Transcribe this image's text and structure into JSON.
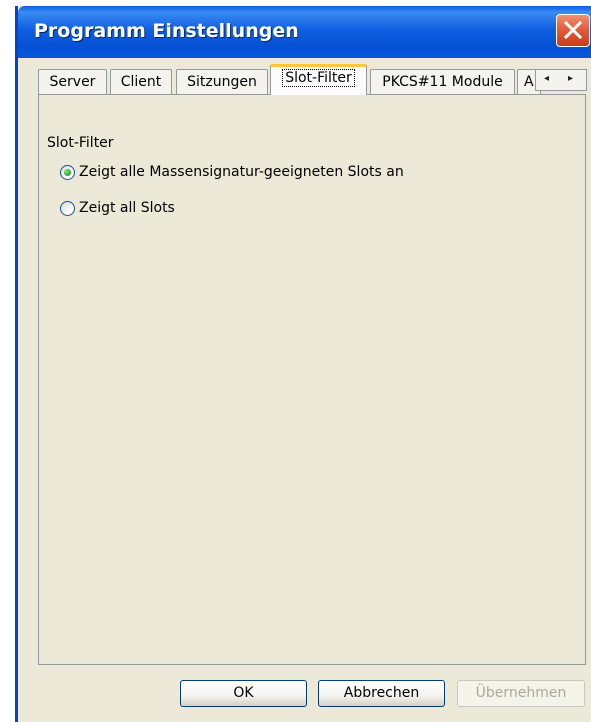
{
  "window": {
    "title": "Programm Einstellungen",
    "close_icon": "close-icon",
    "titlebar_color": "#0a5ee6",
    "close_color": "#e25e3c"
  },
  "tabs": [
    {
      "label": "Server",
      "active": false
    },
    {
      "label": "Client",
      "active": false
    },
    {
      "label": "Sitzungen",
      "active": false
    },
    {
      "label": "Slot-Filter",
      "active": true
    },
    {
      "label": "PKCS#11 Module",
      "active": false
    },
    {
      "label": "A",
      "active": false
    }
  ],
  "tab_scroll": {
    "left_icon": "arrow-left-icon",
    "right_icon": "arrow-right-icon",
    "left": "◂",
    "right": "▸"
  },
  "slot_filter": {
    "group_label": "Slot-Filter",
    "options": [
      {
        "label": "Zeigt alle Massensignatur-geeigneten Slots an",
        "selected": true
      },
      {
        "label": "Zeigt all Slots",
        "selected": false
      }
    ]
  },
  "buttons": {
    "ok": "OK",
    "cancel": "Abbrechen",
    "apply": "Übernehmen"
  }
}
